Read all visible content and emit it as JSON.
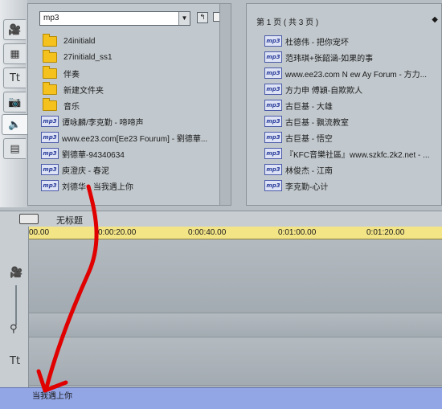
{
  "tabs": [
    {
      "name": "video-tab",
      "glyph": "🎥"
    },
    {
      "name": "transitions-tab",
      "glyph": "▦"
    },
    {
      "name": "title-tab",
      "glyph": "Tt"
    },
    {
      "name": "photo-tab",
      "glyph": "📷"
    },
    {
      "name": "audio-tab",
      "glyph": "🔈"
    },
    {
      "name": "menu-tab",
      "glyph": "▤"
    }
  ],
  "file_browser": {
    "path": "mp3",
    "items": [
      {
        "type": "folder",
        "label": "24initiald"
      },
      {
        "type": "folder",
        "label": "27initiald_ss1"
      },
      {
        "type": "folder",
        "label": "伴奏"
      },
      {
        "type": "folder",
        "label": "新建文件夹"
      },
      {
        "type": "folder",
        "label": "音乐"
      },
      {
        "type": "file",
        "label": "谭咏麟/李克勤 - 啼啼声"
      },
      {
        "type": "file",
        "label": "www.ee23.com[Ee23 Fourum] - 劉德華..."
      },
      {
        "type": "file",
        "label": "劉德華-94340634"
      },
      {
        "type": "file",
        "label": "庾澄庆 - 春泥"
      },
      {
        "type": "file",
        "label": "刘德华 - 当我遇上你"
      }
    ]
  },
  "playlist": {
    "page_header": "第 1 页 ( 共 3 页 )",
    "items": [
      "杜德伟 - 把你宠坏",
      "范玮琪+张韶涵-如果的事",
      "www.ee23.com N ew Ay Forum - 方力...",
      "方力申 傅穎-自欺欺人",
      "古巨基 - 大雄",
      "古巨基 - 飘流教室",
      "古巨基 - 悟空",
      "『KFC音樂社區』www.szkfc.2k2.net - ...",
      "林俊杰 - 江南",
      "李克勤-心计"
    ]
  },
  "timeline": {
    "title": "无标题",
    "ticks": [
      "00.00",
      "0:00:20.00",
      "0:00:40.00",
      "0:01:00.00",
      "0:01:20.00"
    ],
    "audio_clip_label": "当我遇上你"
  },
  "colors": {
    "annotation_arrow": "#e00000",
    "ruler": "#f3e486",
    "audio_clip": "#92a6e6"
  }
}
